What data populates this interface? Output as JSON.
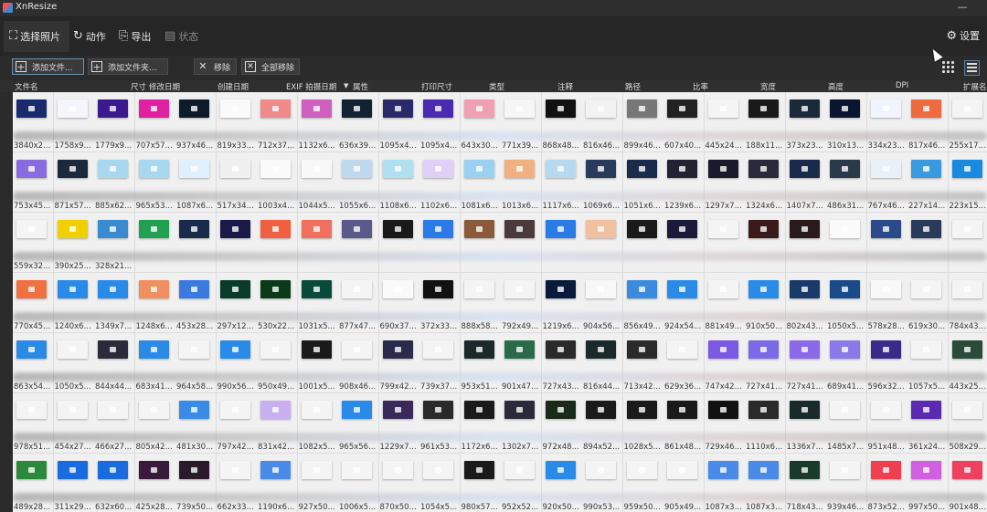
{
  "window": {
    "title": "XnResize",
    "minimize": "—"
  },
  "tabs": [
    {
      "label": "选择照片",
      "icon": "select-photo-icon",
      "glyph": "⛶",
      "active": true
    },
    {
      "label": "动作",
      "icon": "action-icon",
      "glyph": "↻",
      "active": false
    },
    {
      "label": "导出",
      "icon": "export-icon",
      "glyph": "⎘",
      "active": false
    },
    {
      "label": "状态",
      "icon": "status-icon",
      "glyph": "▤",
      "active": false,
      "disabled": true
    }
  ],
  "settings": {
    "label": "设置",
    "icon": "gear-icon",
    "glyph": "⚙"
  },
  "actions": {
    "add_files": "添加文件...",
    "add_folder": "添加文件夹...",
    "remove": "移除",
    "remove_all": "全部移除"
  },
  "columns": [
    "文件名",
    "尺寸",
    "修改日期",
    "创建日期",
    "EXIF 拍摄日期",
    "属性",
    "打印尺寸",
    "类型",
    "注释",
    "路径",
    "比率",
    "宽度",
    "高度",
    "DPI",
    "扩展名"
  ],
  "sort_indicator": "▼",
  "rows": [
    [
      "3840x2...",
      "1758x9...",
      "1779x9...",
      "707x57...",
      "937x46...",
      "819x33...",
      "712x37...",
      "1132x6...",
      "636x39...",
      "1095x4...",
      "1095x4...",
      "643x30...",
      "771x39...",
      "868x48...",
      "816x46...",
      "899x46...",
      "607x40...",
      "445x24...",
      "188x11...",
      "373x23...",
      "310x13...",
      "334x23...",
      "817x46...",
      "255x17..."
    ],
    [
      "753x45...",
      "871x57...",
      "885x62...",
      "965x53...",
      "1087x6...",
      "517x34...",
      "1003x4...",
      "1044x5...",
      "1055x6...",
      "1108x6...",
      "1102x6...",
      "1081x6...",
      "1013x6...",
      "1117x6...",
      "1069x6...",
      "1051x6...",
      "1239x6...",
      "1297x7...",
      "1324x6...",
      "1407x7...",
      "486x31...",
      "767x46...",
      "227x14...",
      "223x15..."
    ],
    [
      "559x32...",
      "390x25...",
      "328x21...",
      "",
      "",
      "",
      "",
      "",
      "",
      "",
      "",
      "",
      "",
      "",
      "",
      "",
      "",
      "",
      "",
      "",
      "",
      "",
      "",
      ""
    ],
    [
      "770x45...",
      "1240x6...",
      "1349x7...",
      "1248x6...",
      "453x28...",
      "297x12...",
      "530x22...",
      "1031x5...",
      "877x47...",
      "690x37...",
      "372x33...",
      "888x58...",
      "792x49...",
      "1219x6...",
      "904x56...",
      "856x49...",
      "924x54...",
      "881x49...",
      "910x50...",
      "802x43...",
      "1050x5...",
      "578x28...",
      "619x30...",
      "784x43..."
    ],
    [
      "863x54...",
      "1050x5...",
      "844x44...",
      "683x41...",
      "964x58...",
      "990x56...",
      "950x49...",
      "1001x5...",
      "908x46...",
      "799x42...",
      "739x37...",
      "953x51...",
      "901x47...",
      "727x43...",
      "816x44...",
      "713x42...",
      "629x36...",
      "747x42...",
      "727x41...",
      "727x41...",
      "689x41...",
      "596x32...",
      "1057x5...",
      "443x25..."
    ],
    [
      "978x51...",
      "454x27...",
      "466x27...",
      "805x42...",
      "481x30...",
      "797x42...",
      "831x42...",
      "1082x5...",
      "965x56...",
      "1229x7...",
      "961x53...",
      "1172x6...",
      "1302x7...",
      "972x48...",
      "894x52...",
      "1028x5...",
      "861x48...",
      "729x46...",
      "1110x6...",
      "1336x7...",
      "1485x7...",
      "951x48...",
      "361x24...",
      "508x29..."
    ],
    [
      "489x28...",
      "311x29...",
      "632x60...",
      "425x28...",
      "739x50...",
      "662x33...",
      "1190x6...",
      "927x50...",
      "1006x5...",
      "870x50...",
      "1054x5...",
      "980x57...",
      "952x52...",
      "920x50...",
      "990x53...",
      "959x50...",
      "905x49...",
      "1087x3...",
      "1087x3...",
      "718x43...",
      "939x46...",
      "873x52...",
      "997x50...",
      "901x48..."
    ]
  ],
  "thumb_colors": [
    [
      "#1a2a6e",
      "#f4f6fb",
      "#3a1a8e",
      "#e020a0",
      "#0d1b2a",
      "#fafafa",
      "#f08a8a",
      "#d060c0",
      "#123",
      "#2a2a6a",
      "#4a2ab0",
      "#f0a0b0",
      "#f6f6f6",
      "#111",
      "#f2f2f2",
      "#777",
      "#222",
      "#f4f4f4",
      "#1a1a1a",
      "#1b2a3a",
      "#0a1530",
      "#f0f4ff",
      "#f06a40",
      "#f4f4f4"
    ],
    [
      "#8a6ae0",
      "#1a2a3a",
      "#a8d8f0",
      "#a8d8f0",
      "#e0f0ff",
      "#f0f0f0",
      "#fafafa",
      "#f8f8f8",
      "#c0d8ee",
      "#b0e0f0",
      "#e0d0f8",
      "#9ad0f0",
      "#f0b080",
      "#b8d8f0",
      "#2a3a5a",
      "#1a2a4a",
      "#223",
      "#1a1a2a",
      "#2a2a3a",
      "#1a2a4a",
      "#2a3a4a",
      "#e8f0f8",
      "#3a9ae0",
      "#1a8ae0"
    ],
    [
      "#f4f4f4",
      "#f0d000",
      "#3a8ad0",
      "#20a050",
      "#1a2a4a",
      "#1a1a4a",
      "#f06040",
      "#f07060",
      "#5a5a8a",
      "#1a1a1a",
      "#2a7ae8",
      "#8a5a3a",
      "#4a3a3a",
      "#2a7ae8",
      "#f0c0a0",
      "#1a1a1a",
      "#1a1a3a",
      "#f4f4f4",
      "#3a1a1a",
      "#2a1a1a",
      "#fafafa",
      "#2a4a8a",
      "#2a3a5a",
      "#f4f4f4"
    ],
    [
      "#f07040",
      "#2a8ae8",
      "#2a8ae8",
      "#f09060",
      "#3a7ae0",
      "#0a3a2a",
      "#0a3a1a",
      "#0a4a3a",
      "#f4f4f4",
      "#fafafa",
      "#111",
      "#f4f4f4",
      "#f4f4f4",
      "#0a1a3a",
      "#f8f8f8",
      "#3a8ae0",
      "#2a8ae8",
      "#f4f4f4",
      "#2a8ae8",
      "#1a3a6a",
      "#1a4a8a",
      "#f8f8f8",
      "#f4f4f4",
      "#f4f4f4"
    ],
    [
      "#2a8ae8",
      "#f4f4f4",
      "#2a2a3a",
      "#2a8ae8",
      "#f4f4f4",
      "#2a8ae8",
      "#f4f4f4",
      "#1a1a1a",
      "#f4f4f4",
      "#2a2a4a",
      "#f4f4f4",
      "#1a2a2a",
      "#2a6a4a",
      "#2a2a2a",
      "#1a2a2a",
      "#2a2a2a",
      "#f4f4f4",
      "#7a5ae0",
      "#7a6ae8",
      "#8a6ae8",
      "#8a7ae8",
      "#3a2a8a",
      "#f4f4f4",
      "#2a4a3a"
    ],
    [
      "#f4f4f4",
      "#f4f4f4",
      "#f4f4f4",
      "#f4f4f4",
      "#3a8ae8",
      "#f4f4f4",
      "#c8b0f0",
      "#f4f4f4",
      "#2a8ae8",
      "#3a2a5a",
      "#2a2a2a",
      "#1a1a1a",
      "#2a2a3a",
      "#1a2a1a",
      "#1a1a1a",
      "#1a1a1a",
      "#1a1a1a",
      "#111",
      "#2a2a2a",
      "#1a2a2a",
      "#f4f4f4",
      "#f4f4f4",
      "#5a2ab0",
      "#f4f4f4"
    ],
    [
      "#2a8a3a",
      "#1a6ae0",
      "#1a6ae0",
      "#3a1a3a",
      "#2a1a2a",
      "#f4f4f4",
      "#4a8ae8",
      "#f4f4f4",
      "#f4f4f4",
      "#f4f4f4",
      "#f4f4f4",
      "#1a1a1a",
      "#f4f4f4",
      "#2a8ae8",
      "#f4f4f4",
      "#f4f4f4",
      "#f4f4f4",
      "#4a8ae8",
      "#4a8ae8",
      "#1a3a2a",
      "#f4f4f4",
      "#f04050",
      "#d060e0",
      "#f04060"
    ]
  ]
}
